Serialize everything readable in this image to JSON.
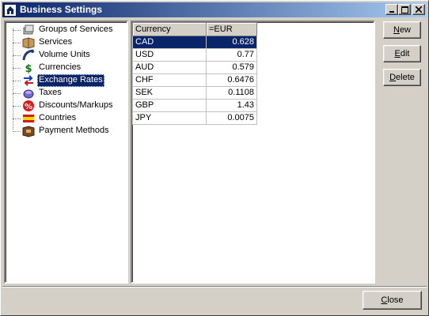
{
  "window": {
    "title": "Business Settings",
    "minimize_glyph": "_",
    "maximize_glyph": "□",
    "close_glyph": "×"
  },
  "tree": {
    "items": [
      {
        "label": "Groups of Services",
        "icon": "groups-icon"
      },
      {
        "label": "Services",
        "icon": "services-icon"
      },
      {
        "label": "Volume Units",
        "icon": "volume-units-icon"
      },
      {
        "label": "Currencies",
        "icon": "dollar-icon"
      },
      {
        "label": "Exchange Rates",
        "icon": "exchange-arrows-icon",
        "selected": true
      },
      {
        "label": "Taxes",
        "icon": "taxes-icon"
      },
      {
        "label": "Discounts/Markups",
        "icon": "percent-icon"
      },
      {
        "label": "Countries",
        "icon": "flag-icon"
      },
      {
        "label": "Payment Methods",
        "icon": "payment-icon"
      }
    ]
  },
  "grid": {
    "columns": [
      "Currency",
      "=EUR"
    ],
    "rows": [
      {
        "code": "CAD",
        "rate": "0.628",
        "selected": true
      },
      {
        "code": "USD",
        "rate": "0.77"
      },
      {
        "code": "AUD",
        "rate": "0.579"
      },
      {
        "code": "CHF",
        "rate": "0.6476"
      },
      {
        "code": "SEK",
        "rate": "0.1108"
      },
      {
        "code": "GBP",
        "rate": "1.43"
      },
      {
        "code": "JPY",
        "rate": "0.0075"
      }
    ]
  },
  "buttons": {
    "new_mnemonic": "N",
    "new_rest": "ew",
    "edit_mnemonic": "E",
    "edit_rest": "dit",
    "delete_mnemonic": "D",
    "delete_rest": "elete",
    "close_mnemonic": "C",
    "close_rest": "lose"
  },
  "colors": {
    "selection": "#0a246a",
    "face": "#d4d0c8"
  }
}
